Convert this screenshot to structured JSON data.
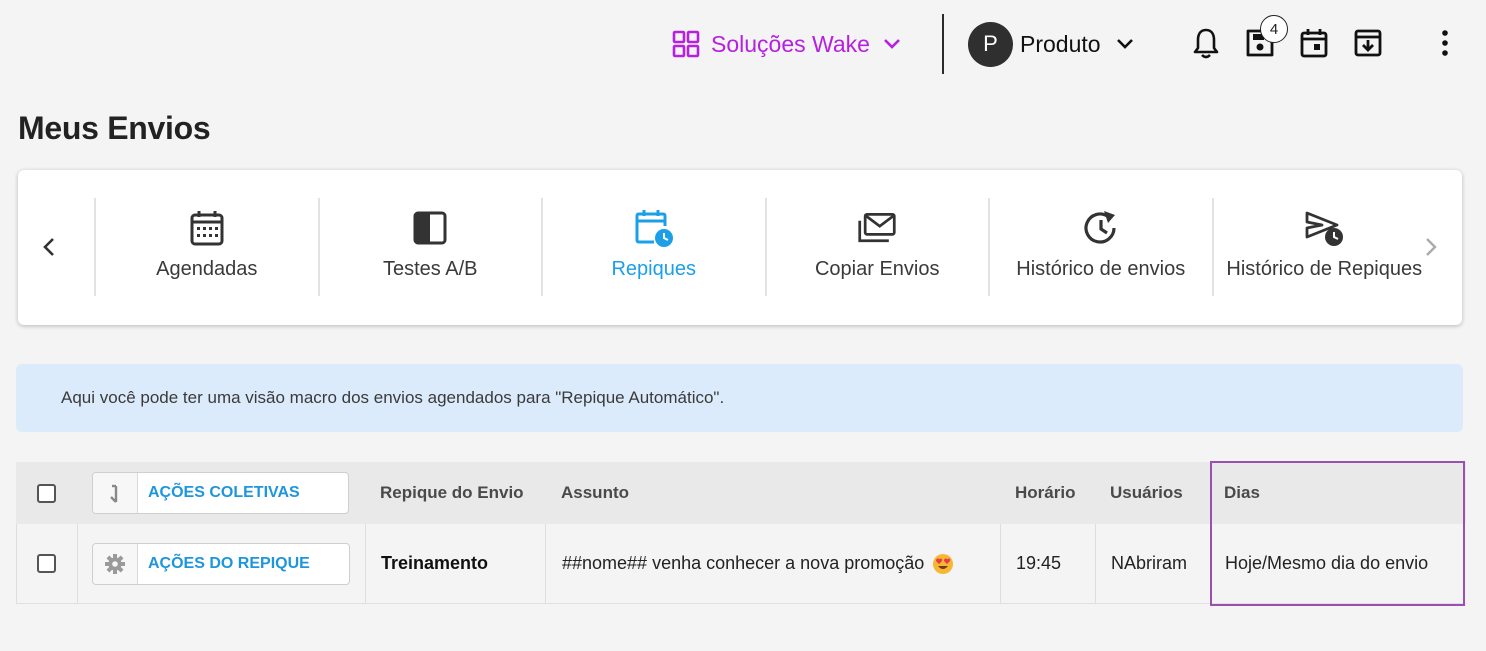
{
  "header": {
    "solutions_label": "Soluções Wake",
    "account_initial": "P",
    "account_name": "Produto",
    "notification_count": "4"
  },
  "page": {
    "title": "Meus Envios"
  },
  "tabs": [
    {
      "label": "Agendadas",
      "icon": "calendar-icon",
      "active": false
    },
    {
      "label": "Testes A/B",
      "icon": "split-square-icon",
      "active": false
    },
    {
      "label": "Repiques",
      "icon": "calendar-clock-icon",
      "active": true
    },
    {
      "label": "Copiar Envios",
      "icon": "envelopes-icon",
      "active": false
    },
    {
      "label": "Histórico de envios",
      "icon": "history-icon",
      "active": false
    },
    {
      "label": "Histórico de Repiques",
      "icon": "send-clock-icon",
      "active": false
    }
  ],
  "info_banner": "Aqui você pode ter uma visão macro dos envios agendados para \"Repique Automático\".",
  "table": {
    "bulk_actions_label": "AÇÕES COLETIVAS",
    "columns": [
      "Repique do Envio",
      "Assunto",
      "Horário",
      "Usuários",
      "Dias"
    ],
    "rows": [
      {
        "actions_label": "AÇÕES DO REPIQUE",
        "repique": "Treinamento",
        "assunto": "##nome## venha conhecer a nova promoção",
        "horario": "19:45",
        "usuarios": "NAbriram",
        "dias": "Hoje/Mesmo dia do envio"
      }
    ]
  },
  "colors": {
    "accent_purple": "#b620e0",
    "accent_blue": "#1ba0e8",
    "highlight_border": "#9b4fb1",
    "info_bg": "#dcebfc"
  }
}
